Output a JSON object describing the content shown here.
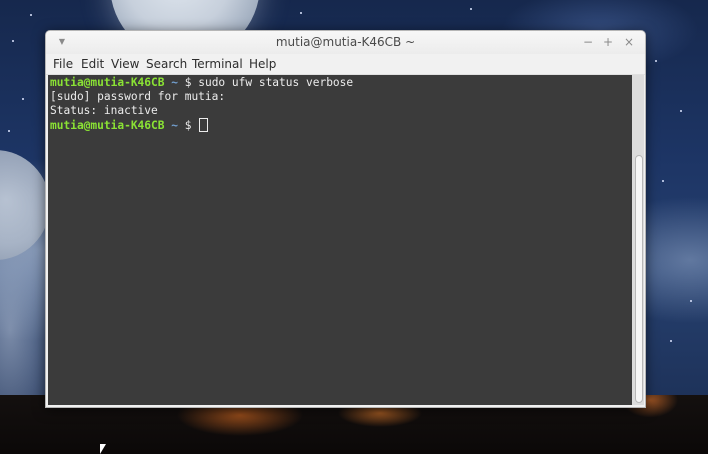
{
  "window": {
    "title": "mutia@mutia-K46CB ~",
    "menu_icon": "chevron-down-icon",
    "controls": {
      "minimize": "−",
      "maximize": "+",
      "close": "×"
    }
  },
  "menubar": {
    "items": [
      "File",
      "Edit",
      "View",
      "Search",
      "Terminal",
      "Help"
    ]
  },
  "terminal": {
    "line1": {
      "user_host": "mutia@mutia-K46CB",
      "path": " ~ ",
      "symbol": "$ ",
      "command": "sudo ufw status verbose"
    },
    "line2": "[sudo] password for mutia:",
    "line3": "Status: inactive",
    "line4": {
      "user_host": "mutia@mutia-K46CB",
      "path": " ~ ",
      "symbol": "$ "
    }
  },
  "colors": {
    "terminal_bg": "#3b3b3b",
    "prompt_user": "#8ae234",
    "prompt_path": "#729fcf",
    "text": "#ececec"
  }
}
